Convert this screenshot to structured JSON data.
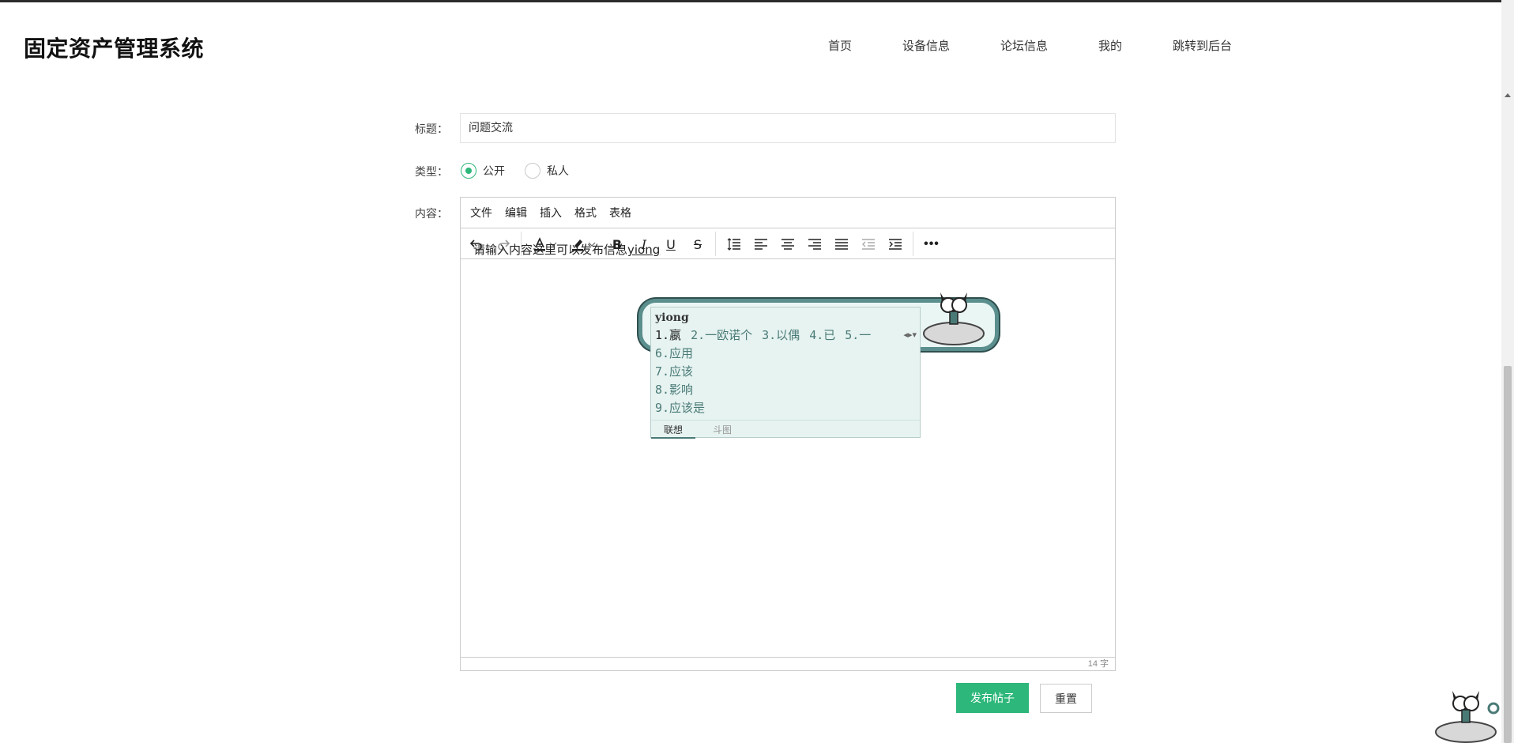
{
  "app": {
    "title": "固定资产管理系统"
  },
  "nav": {
    "items": [
      {
        "label": "首页"
      },
      {
        "label": "设备信息"
      },
      {
        "label": "论坛信息"
      },
      {
        "label": "我的"
      },
      {
        "label": "跳转到后台"
      }
    ]
  },
  "form": {
    "title_label": "标题：",
    "title_value": "问题交流",
    "type_label": "类型：",
    "type_options": [
      {
        "label": "公开",
        "checked": true
      },
      {
        "label": "私人",
        "checked": false
      }
    ],
    "content_label": "内容："
  },
  "editor": {
    "menu": [
      "文件",
      "编辑",
      "插入",
      "格式",
      "表格"
    ],
    "toolbar_icons": [
      "undo-icon",
      "redo-icon",
      "text-color-icon",
      "highlight-color-icon",
      "bold-icon",
      "italic-icon",
      "underline-icon",
      "strikethrough-icon",
      "line-height-icon",
      "align-left-icon",
      "align-center-icon",
      "align-right-icon",
      "align-justify-icon",
      "outdent-icon",
      "indent-icon",
      "more-icon"
    ],
    "content_text": "请输入内容这里可以发布信息",
    "composing_text": "yiong",
    "word_count": "14 字"
  },
  "ime": {
    "pinyin": "yiong",
    "candidates": [
      "1.嬴",
      "2.一欧诺个",
      "3.以偶",
      "4.已",
      "5.一"
    ],
    "list": [
      "6.应用",
      "7.应该",
      "8.影响",
      "9.应该是"
    ],
    "tabs": [
      "联想",
      "斗图"
    ]
  },
  "buttons": {
    "submit": "发布帖子",
    "reset": "重置"
  },
  "colors": {
    "accent": "#2db77a"
  }
}
